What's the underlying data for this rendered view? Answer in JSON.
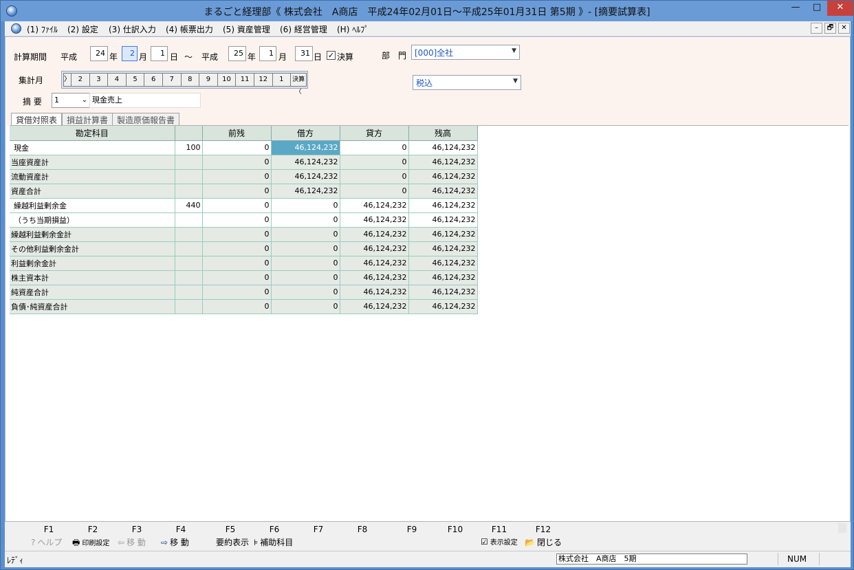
{
  "window": {
    "title": "まるごと経理部《 株式会社　A商店　平成24年02月01日～平成25年01月31日 第5期 》- [摘要試算表]",
    "minimize": "—",
    "maximize": "□",
    "close": "✕"
  },
  "menu": {
    "items": [
      "(1) ﾌｧｲﾙ",
      "(2) 設定",
      "(3) 仕訳入力",
      "(4) 帳票出力",
      "(5) 資産管理",
      "(6) 経営管理",
      "(H) ﾍﾙﾌﾟ"
    ],
    "mdi_min": "–",
    "mdi_restore": "🗗",
    "mdi_close": "✕"
  },
  "form": {
    "period_label": "計算期間",
    "era1": "平成",
    "from_year": "24",
    "year_unit": "年",
    "from_month": "2",
    "month_unit": "月",
    "from_day": "1",
    "day_unit": "日",
    "tilde": "～",
    "era2": "平成",
    "to_year": "25",
    "to_month": "1",
    "to_day": "31",
    "closing_checked": "✓",
    "closing_label": "決算",
    "dept_label": "部　門",
    "dept_value": "[000]全社",
    "tax_value": "税込",
    "agg_month_label": "集計月",
    "months": [
      "〉",
      "2",
      "3",
      "4",
      "5",
      "6",
      "7",
      "8",
      "9",
      "10",
      "11",
      "12",
      "1",
      "決算〈"
    ],
    "summary_label": "摘 要",
    "summary_code": "1",
    "summary_text": "現金売上"
  },
  "tabs": [
    "貸借対照表",
    "損益計算書",
    "製造原価報告書"
  ],
  "table": {
    "headers": [
      "勘定科目",
      "",
      "前残",
      "借方",
      "貸方",
      "残高"
    ],
    "rows": [
      {
        "name": "現金",
        "code": "100",
        "prev": "0",
        "debit": "46,124,232",
        "credit": "0",
        "balance": "46,124,232",
        "type": "acc"
      },
      {
        "name": "当座資産計",
        "code": "",
        "prev": "0",
        "debit": "46,124,232",
        "credit": "0",
        "balance": "46,124,232",
        "type": "sum"
      },
      {
        "name": "流動資産計",
        "code": "",
        "prev": "0",
        "debit": "46,124,232",
        "credit": "0",
        "balance": "46,124,232",
        "type": "sum"
      },
      {
        "name": "資産合計",
        "code": "",
        "prev": "0",
        "debit": "46,124,232",
        "credit": "0",
        "balance": "46,124,232",
        "type": "sum"
      },
      {
        "name": "繰越利益剰余金",
        "code": "440",
        "prev": "0",
        "debit": "0",
        "credit": "46,124,232",
        "balance": "46,124,232",
        "type": "acc"
      },
      {
        "name": "（うち当期損益）",
        "code": "",
        "prev": "0",
        "debit": "0",
        "credit": "46,124,232",
        "balance": "46,124,232",
        "type": "acc"
      },
      {
        "name": "繰越利益剰余金計",
        "code": "",
        "prev": "0",
        "debit": "0",
        "credit": "46,124,232",
        "balance": "46,124,232",
        "type": "sum"
      },
      {
        "name": "その他利益剰余金計",
        "code": "",
        "prev": "0",
        "debit": "0",
        "credit": "46,124,232",
        "balance": "46,124,232",
        "type": "sum"
      },
      {
        "name": "利益剰余金計",
        "code": "",
        "prev": "0",
        "debit": "0",
        "credit": "46,124,232",
        "balance": "46,124,232",
        "type": "sum"
      },
      {
        "name": "株主資本計",
        "code": "",
        "prev": "0",
        "debit": "0",
        "credit": "46,124,232",
        "balance": "46,124,232",
        "type": "sum"
      },
      {
        "name": "純資産合計",
        "code": "",
        "prev": "0",
        "debit": "0",
        "credit": "46,124,232",
        "balance": "46,124,232",
        "type": "sum"
      },
      {
        "name": "負債･純資産合計",
        "code": "",
        "prev": "0",
        "debit": "0",
        "credit": "46,124,232",
        "balance": "46,124,232",
        "type": "sum"
      }
    ]
  },
  "fkeys": {
    "keys": [
      "F1",
      "F2",
      "F3",
      "F4",
      "F5",
      "F6",
      "F7",
      "F8",
      "F9",
      "F10",
      "F11",
      "F12"
    ],
    "f1": {
      "icon": "?",
      "label": "ヘルプ"
    },
    "f2": {
      "icon": "🖶",
      "label": "印刷設定"
    },
    "f3": {
      "icon": "⇦",
      "label": "移 動"
    },
    "f4": {
      "icon": "⇨",
      "label": "移 動"
    },
    "f5": {
      "label": "要約表示"
    },
    "f6": {
      "icon": "⊧",
      "label": "補助科目"
    },
    "f11": {
      "icon": "☑",
      "label": "表示設定"
    },
    "f12": {
      "icon": "📂",
      "label": "閉じる"
    }
  },
  "status": {
    "ready": "ﾚﾃﾞｨ",
    "company": "株式会社　A商店　5期",
    "num": "NUM"
  }
}
